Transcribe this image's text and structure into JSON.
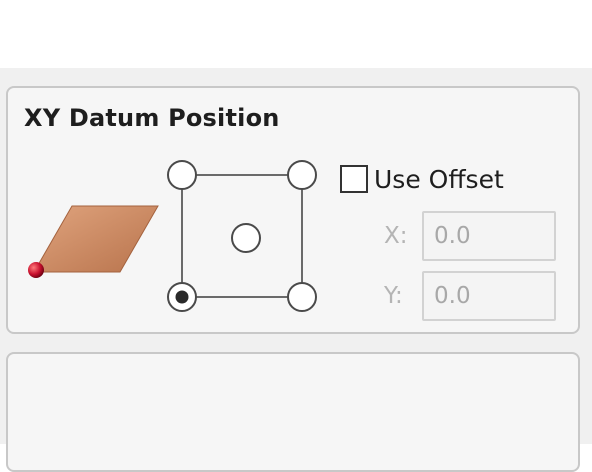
{
  "xy_datum": {
    "title": "XY Datum Position",
    "selected_position": "bottom-left",
    "positions": [
      "top-left",
      "top-right",
      "center",
      "bottom-left",
      "bottom-right"
    ],
    "use_offset": {
      "label": "Use Offset",
      "checked": false
    },
    "offset_x": {
      "label": "X:",
      "value": "0.0",
      "enabled": false
    },
    "offset_y": {
      "label": "Y:",
      "value": "0.0",
      "enabled": false
    }
  },
  "colors": {
    "material_light": "#e0a47e",
    "material_dark": "#b8734c",
    "origin_marker": "#c8102e",
    "disabled_text": "#b4b4b4",
    "panel_border": "#c8c8c8"
  },
  "icons": {
    "material": "material-plate-icon",
    "origin": "origin-marker-icon"
  }
}
